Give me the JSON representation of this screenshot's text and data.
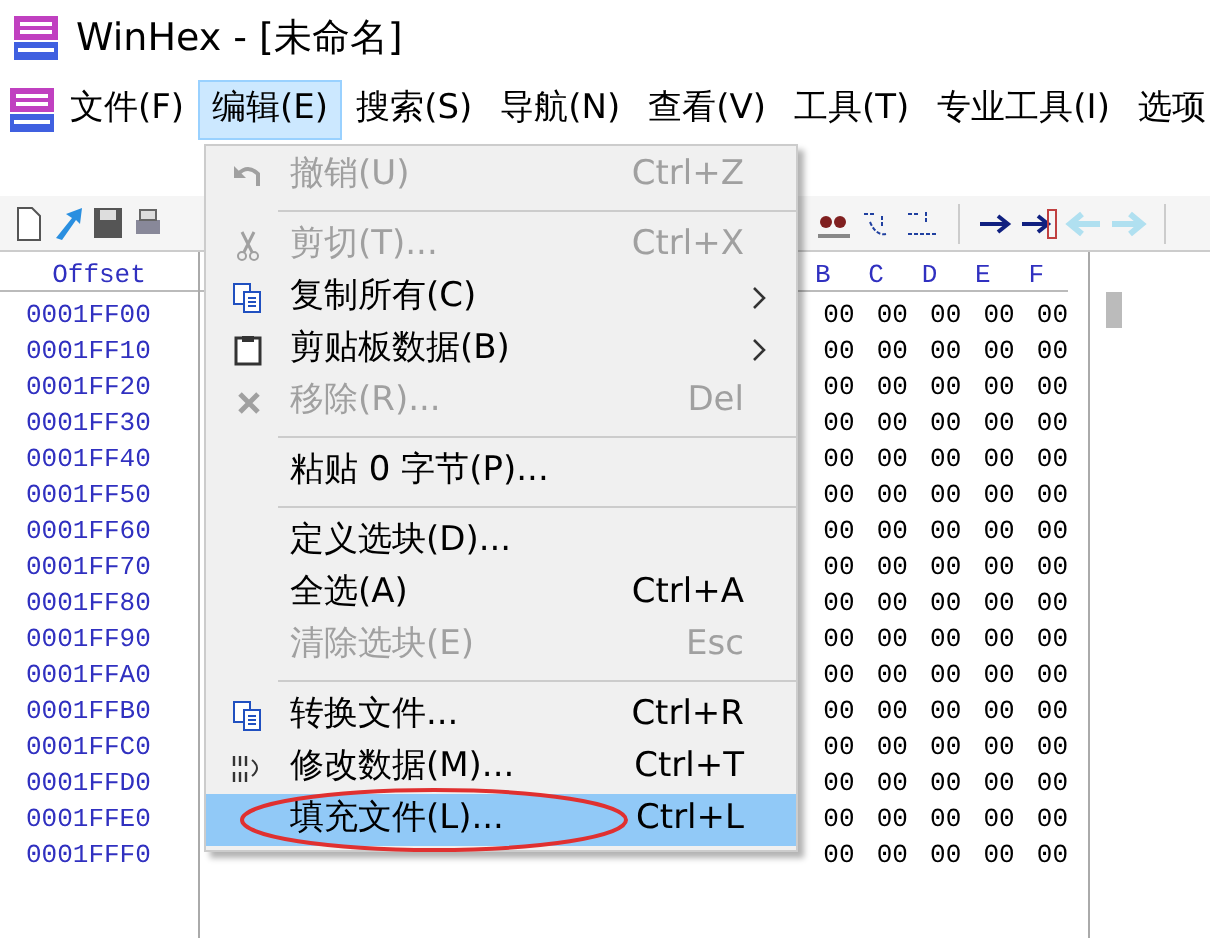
{
  "window": {
    "title": "WinHex - [未命名]"
  },
  "menu_bar": [
    {
      "label": "文件(F)",
      "selected": false
    },
    {
      "label": "编辑(E)",
      "selected": true
    },
    {
      "label": "搜索(S)",
      "selected": false
    },
    {
      "label": "导航(N)",
      "selected": false
    },
    {
      "label": "查看(V)",
      "selected": false
    },
    {
      "label": "工具(T)",
      "selected": false
    },
    {
      "label": "专业工具(I)",
      "selected": false
    },
    {
      "label": "选项",
      "selected": false
    }
  ],
  "hex_view": {
    "offset_header": "Offset",
    "columns": [
      "B",
      "C",
      "D",
      "E",
      "F"
    ],
    "rows": [
      {
        "offset": "0001FF00",
        "bytes": [
          "00",
          "00",
          "00",
          "00",
          "00"
        ]
      },
      {
        "offset": "0001FF10",
        "bytes": [
          "00",
          "00",
          "00",
          "00",
          "00"
        ]
      },
      {
        "offset": "0001FF20",
        "bytes": [
          "00",
          "00",
          "00",
          "00",
          "00"
        ]
      },
      {
        "offset": "0001FF30",
        "bytes": [
          "00",
          "00",
          "00",
          "00",
          "00"
        ]
      },
      {
        "offset": "0001FF40",
        "bytes": [
          "00",
          "00",
          "00",
          "00",
          "00"
        ]
      },
      {
        "offset": "0001FF50",
        "bytes": [
          "00",
          "00",
          "00",
          "00",
          "00"
        ]
      },
      {
        "offset": "0001FF60",
        "bytes": [
          "00",
          "00",
          "00",
          "00",
          "00"
        ]
      },
      {
        "offset": "0001FF70",
        "bytes": [
          "00",
          "00",
          "00",
          "00",
          "00"
        ]
      },
      {
        "offset": "0001FF80",
        "bytes": [
          "00",
          "00",
          "00",
          "00",
          "00"
        ]
      },
      {
        "offset": "0001FF90",
        "bytes": [
          "00",
          "00",
          "00",
          "00",
          "00"
        ]
      },
      {
        "offset": "0001FFA0",
        "bytes": [
          "00",
          "00",
          "00",
          "00",
          "00"
        ]
      },
      {
        "offset": "0001FFB0",
        "bytes": [
          "00",
          "00",
          "00",
          "00",
          "00"
        ]
      },
      {
        "offset": "0001FFC0",
        "bytes": [
          "00",
          "00",
          "00",
          "00",
          "00"
        ]
      },
      {
        "offset": "0001FFD0",
        "bytes": [
          "00",
          "00",
          "00",
          "00",
          "00"
        ]
      },
      {
        "offset": "0001FFE0",
        "bytes": [
          "00",
          "00",
          "00",
          "00",
          "00"
        ]
      },
      {
        "offset": "0001FFF0",
        "bytes": [
          "00",
          "00",
          "00",
          "00",
          "00"
        ]
      }
    ]
  },
  "edit_menu": [
    {
      "kind": "item",
      "label": "撤销(U)",
      "shortcut": "Ctrl+Z",
      "disabled": true,
      "selected": false,
      "submenu": false
    },
    {
      "kind": "separator"
    },
    {
      "kind": "item",
      "label": "剪切(T)...",
      "shortcut": "Ctrl+X",
      "disabled": true,
      "selected": false,
      "submenu": false
    },
    {
      "kind": "item",
      "label": "复制所有(C)",
      "disabled": false,
      "selected": false,
      "submenu": true
    },
    {
      "kind": "item",
      "label": "剪贴板数据(B)",
      "disabled": false,
      "selected": false,
      "submenu": true
    },
    {
      "kind": "item",
      "label": "移除(R)...",
      "shortcut": "Del",
      "disabled": true,
      "selected": false,
      "submenu": false
    },
    {
      "kind": "separator"
    },
    {
      "kind": "item",
      "label": "粘贴 0 字节(P)...",
      "disabled": false,
      "selected": false,
      "submenu": false
    },
    {
      "kind": "separator"
    },
    {
      "kind": "item",
      "label": "定义选块(D)...",
      "disabled": false,
      "selected": false,
      "submenu": false
    },
    {
      "kind": "item",
      "label": "全选(A)",
      "shortcut": "Ctrl+A",
      "disabled": false,
      "selected": false,
      "submenu": false
    },
    {
      "kind": "item",
      "label": "清除选块(E)",
      "shortcut": "Esc",
      "disabled": true,
      "selected": false,
      "submenu": false
    },
    {
      "kind": "separator"
    },
    {
      "kind": "item",
      "label": "转换文件...",
      "shortcut": "Ctrl+R",
      "disabled": false,
      "selected": false,
      "submenu": false
    },
    {
      "kind": "item",
      "label": "修改数据(M)...",
      "shortcut": "Ctrl+T",
      "disabled": false,
      "selected": false,
      "submenu": false
    },
    {
      "kind": "item",
      "label": "填充文件(L)...",
      "shortcut": "Ctrl+L",
      "disabled": false,
      "selected": true,
      "submenu": false
    }
  ]
}
